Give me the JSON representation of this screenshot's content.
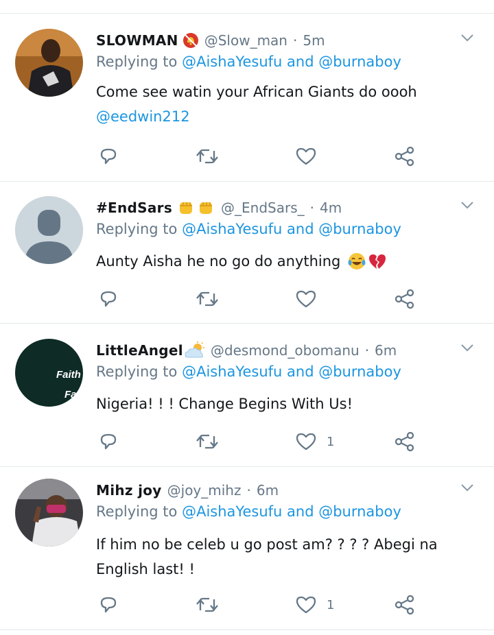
{
  "tweets": [
    {
      "name": "SLOWMAN",
      "handle": "@Slow_man",
      "time": "5m",
      "reply_label": "Replying to",
      "reply_to_1": "@AishaYesufu",
      "reply_and": "and",
      "reply_to_2": "@burnaboy",
      "text": "Come see watin your African Giants do oooh",
      "mention_line": "@eedwin212",
      "like_count": ""
    },
    {
      "name": "#EndSars",
      "handle": "@_EndSars_",
      "time": "4m",
      "reply_label": "Replying to",
      "reply_to_1": "@AishaYesufu",
      "reply_and": "and",
      "reply_to_2": "@burnaboy",
      "text": "Aunty Aisha he no go do anything",
      "like_count": ""
    },
    {
      "name": "LittleAngel",
      "handle": "@desmond_obomanu",
      "time": "6m",
      "reply_label": "Replying to",
      "reply_to_1": "@AishaYesufu",
      "reply_and": "and",
      "reply_to_2": "@burnaboy",
      "text": "Nigeria! ! !  Change Begins With Us!",
      "avatar_text_1": "Faith",
      "avatar_text_2": "Fa",
      "like_count": "1"
    },
    {
      "name": "Mihz joy",
      "handle": "@joy_mihz",
      "time": "6m",
      "reply_label": "Replying to",
      "reply_to_1": "@AishaYesufu",
      "reply_and": "and",
      "reply_to_2": "@burnaboy",
      "text_line_1": "If him no be celeb u go post am? ? ? ?  Abegi na",
      "text_line_2": "English last! !",
      "like_count": "1"
    }
  ],
  "icons": {
    "reply": "reply-icon",
    "retweet": "retweet-icon",
    "like": "heart-icon",
    "share": "share-icon",
    "caret": "chevron-down-icon",
    "emoji_1a": "no-bell-icon",
    "emoji_2a": "raised-fist-icon",
    "emoji_2b": "raised-fist-icon",
    "emoji_2c": "tears-of-joy-icon",
    "emoji_2d": "broken-heart-icon",
    "emoji_3a": "sun-behind-cloud-icon"
  },
  "colors": {
    "link": "#1b95e0",
    "secondary_text": "#657786",
    "icon": "#657786",
    "divider": "#e1e8ed"
  }
}
